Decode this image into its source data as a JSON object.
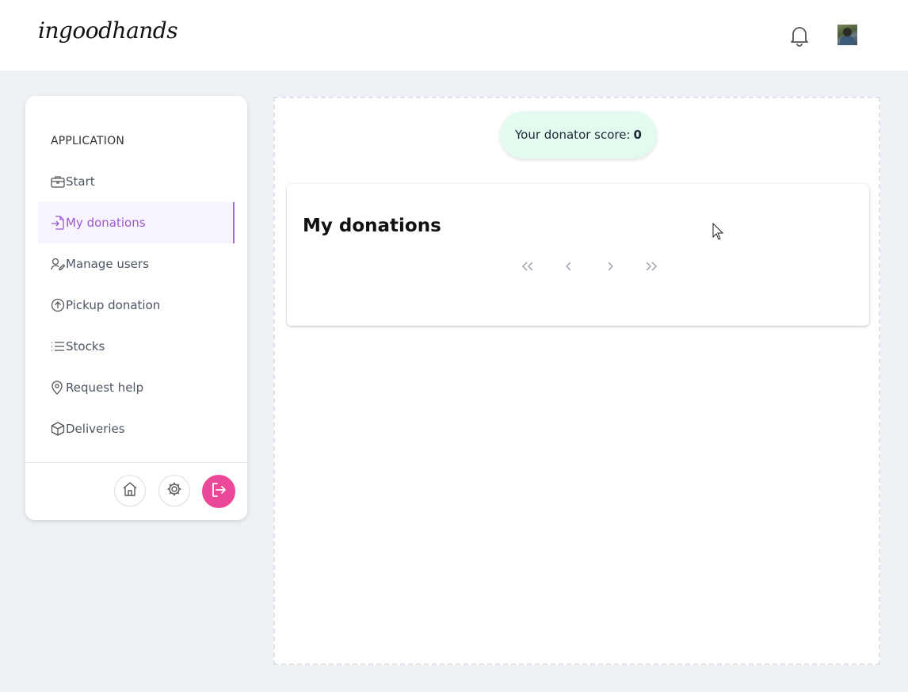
{
  "header": {
    "logo_text": "ingoodhands",
    "notifications_icon": "bell-icon",
    "avatar": "user-avatar"
  },
  "sidebar": {
    "section_title": "APPLICATION",
    "items": [
      {
        "label": "Start",
        "icon": "briefcase-icon",
        "active": false
      },
      {
        "label": "My donations",
        "icon": "file-import-icon",
        "active": true
      },
      {
        "label": "Manage users",
        "icon": "user-edit-icon",
        "active": false
      },
      {
        "label": "Pickup donation",
        "icon": "arrow-up-circle-icon",
        "active": false
      },
      {
        "label": "Stocks",
        "icon": "list-icon",
        "active": false
      },
      {
        "label": "Request help",
        "icon": "map-pin-icon",
        "active": false
      },
      {
        "label": "Deliveries",
        "icon": "box-icon",
        "active": false
      }
    ],
    "footer_buttons": [
      "home-icon",
      "gear-icon",
      "logout-icon"
    ]
  },
  "main": {
    "score_label": "Your donator score:",
    "score_value": "0",
    "card_title": "My donations",
    "pager_icons": [
      "first-page-icon",
      "prev-page-icon",
      "next-page-icon",
      "last-page-icon"
    ]
  },
  "colors": {
    "accent": "#9b59d0",
    "logout": "#ec4899",
    "score_bg": "#e3fbef",
    "page_bg": "#eef1f6"
  }
}
